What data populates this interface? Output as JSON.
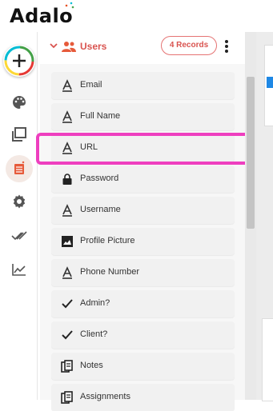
{
  "app": {
    "logo_text": "Adalo"
  },
  "collection": {
    "name": "Users",
    "records_label": "4 Records"
  },
  "fields": [
    {
      "label": "Email",
      "icon": "text-icon"
    },
    {
      "label": "Full Name",
      "icon": "text-icon"
    },
    {
      "label": "URL",
      "icon": "text-icon"
    },
    {
      "label": "Password",
      "icon": "lock-icon"
    },
    {
      "label": "Username",
      "icon": "text-icon"
    },
    {
      "label": "Profile Picture",
      "icon": "image-icon"
    },
    {
      "label": "Phone Number",
      "icon": "text-icon"
    },
    {
      "label": "Admin?",
      "icon": "check-icon"
    },
    {
      "label": "Client?",
      "icon": "check-icon"
    },
    {
      "label": "Notes",
      "icon": "relationship-icon"
    },
    {
      "label": "Assignments",
      "icon": "relationship-icon"
    }
  ],
  "colors": {
    "accent": "#d9534f",
    "highlight": "#ee3fbf",
    "blue": "#1e88e5"
  }
}
